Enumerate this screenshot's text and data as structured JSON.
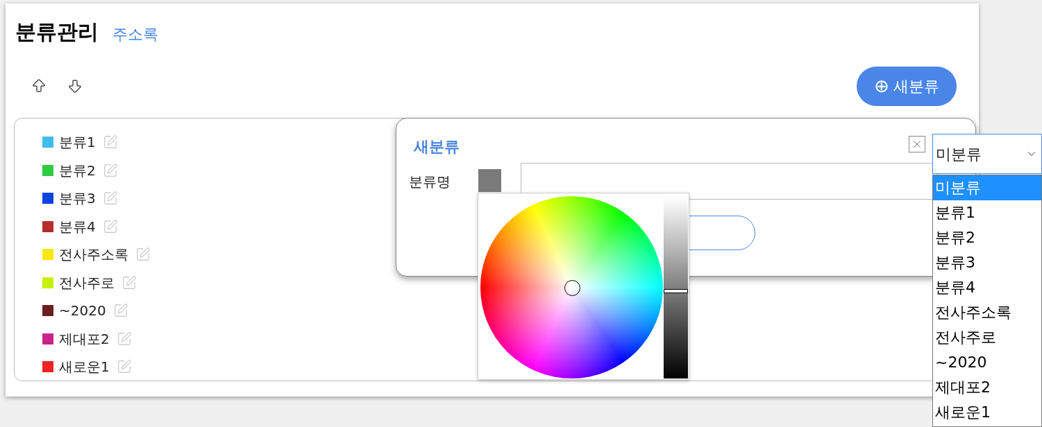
{
  "header": {
    "title": "분류관리",
    "link": "주소록"
  },
  "new_button": {
    "icon": "⊕",
    "label": "새분류"
  },
  "categories": [
    {
      "label": "분류1",
      "color": "#3dbde8"
    },
    {
      "label": "분류2",
      "color": "#2ecc40"
    },
    {
      "label": "분류3",
      "color": "#0b44e0"
    },
    {
      "label": "분류4",
      "color": "#b82c2c"
    },
    {
      "label": "전사주소록",
      "color": "#f7e90f"
    },
    {
      "label": "전사주로",
      "color": "#c8f00f"
    },
    {
      "label": "~2020",
      "color": "#6b1e1e"
    },
    {
      "label": "제대포2",
      "color": "#c8248c"
    },
    {
      "label": "새로운1",
      "color": "#ee2222"
    }
  ],
  "dialog": {
    "title": "새분류",
    "field_label": "분류명",
    "picker": {
      "brightness": {
        "level": 0.48
      }
    }
  },
  "select": {
    "value": "미분류",
    "options": [
      {
        "label": "미분류",
        "selected": true
      },
      {
        "label": "분류1",
        "selected": false
      },
      {
        "label": "분류2",
        "selected": false
      },
      {
        "label": "분류3",
        "selected": false
      },
      {
        "label": "분류4",
        "selected": false
      },
      {
        "label": "전사주소록",
        "selected": false
      },
      {
        "label": "전사주로",
        "selected": false
      },
      {
        "label": "~2020",
        "selected": false
      },
      {
        "label": "제대포2",
        "selected": false
      },
      {
        "label": "새로운1",
        "selected": false
      }
    ]
  }
}
